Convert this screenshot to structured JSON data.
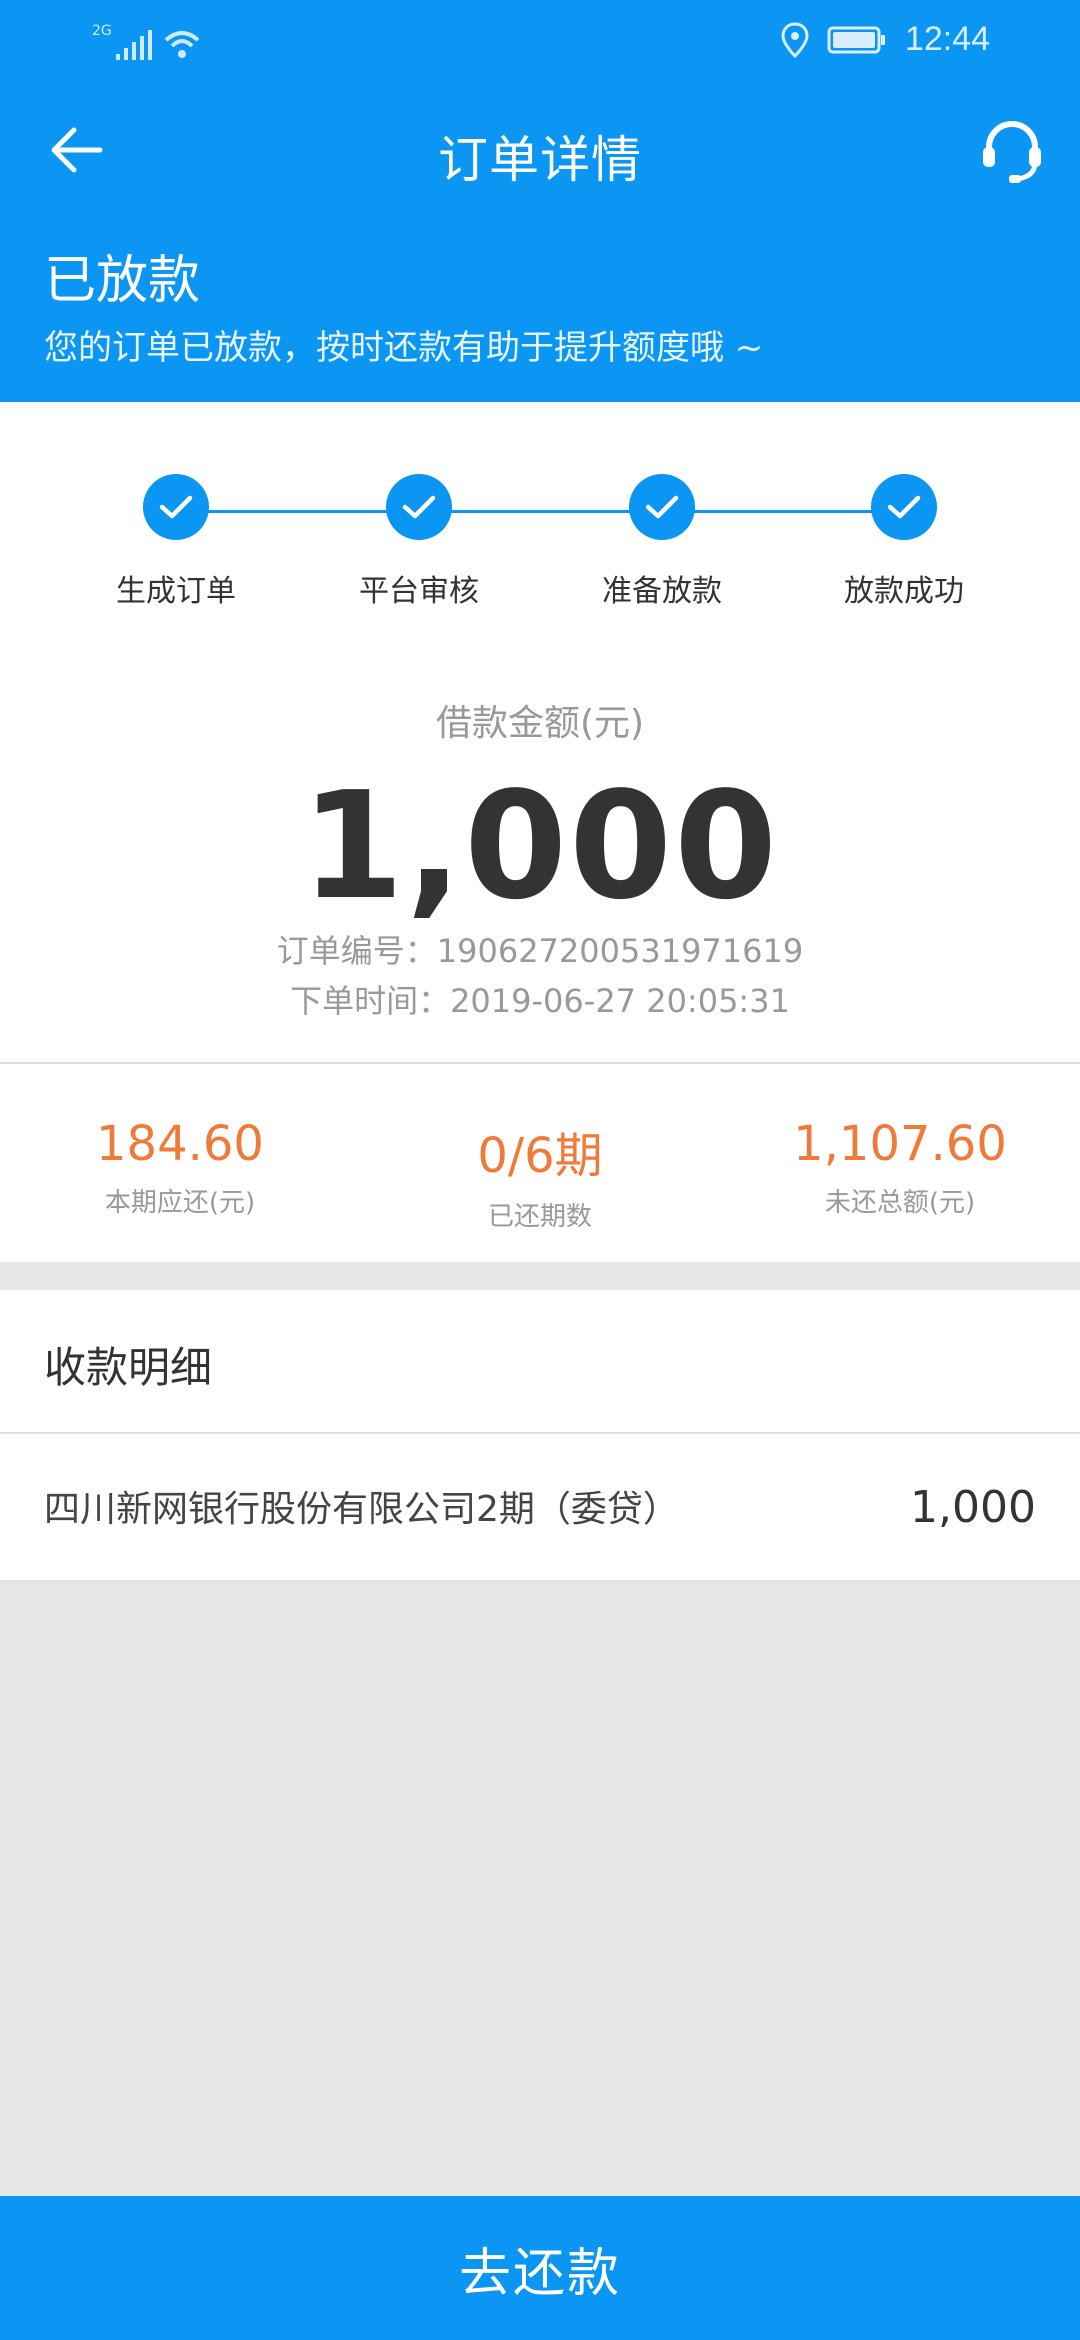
{
  "status_bar": {
    "network": "2G",
    "time": "12:44"
  },
  "header": {
    "title": "订单详情"
  },
  "order_status": {
    "title": "已放款",
    "subtitle": "您的订单已放款，按时还款有助于提升额度哦 ~"
  },
  "progress": {
    "steps": [
      {
        "label": "生成订单",
        "done": true
      },
      {
        "label": "平台审核",
        "done": true
      },
      {
        "label": "准备放款",
        "done": true
      },
      {
        "label": "放款成功",
        "done": true
      }
    ]
  },
  "loan": {
    "amount_label": "借款金额(元)",
    "amount": "1,000",
    "order_no_line": "订单编号：190627200531971619",
    "order_time_line": "下单时间：2019-06-27 20:05:31"
  },
  "stats": [
    {
      "value": "184.60",
      "label": "本期应还(元)"
    },
    {
      "value": "0/6期",
      "label": "已还期数"
    },
    {
      "value": "1,107.60",
      "label": "未还总额(元)"
    }
  ],
  "details": {
    "title": "收款明细",
    "rows": [
      {
        "name": "四川新网银行股份有限公司2期（委贷）",
        "amount": "1,000"
      }
    ]
  },
  "actions": {
    "repay_label": "去还款"
  },
  "colors": {
    "primary": "#0a96f2",
    "accent": "#f07a3a",
    "background": "#e6e6e6"
  },
  "icons": [
    "signal-icon",
    "wifi-icon",
    "location-icon",
    "battery-icon",
    "back-arrow-icon",
    "customer-service-icon",
    "check-icon"
  ]
}
